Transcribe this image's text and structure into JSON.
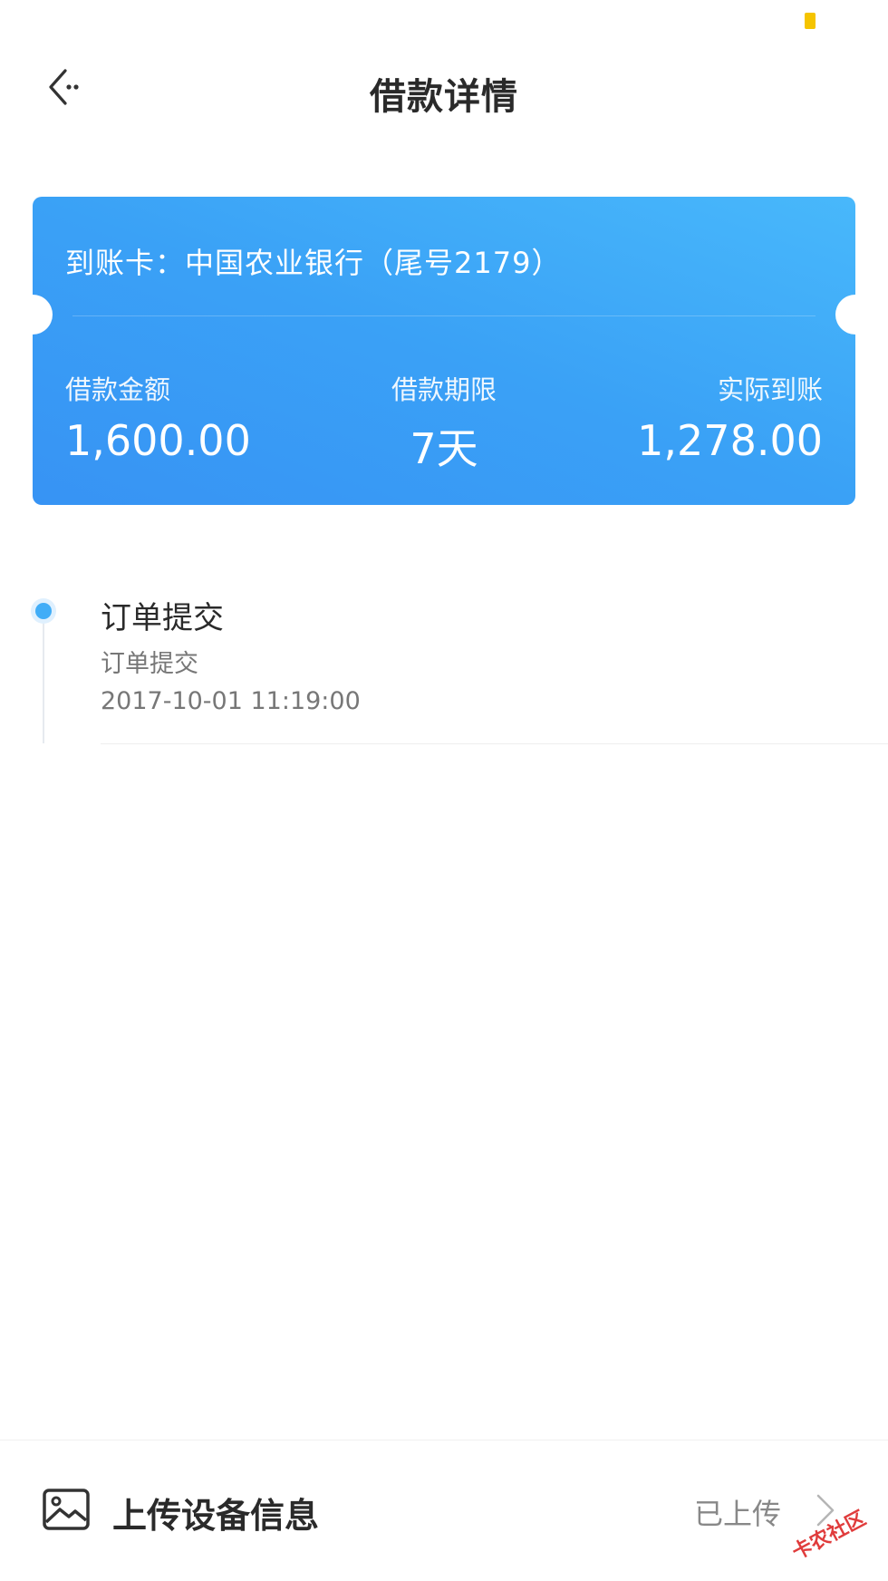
{
  "header": {
    "title": "借款详情",
    "back_icon": "back-arrow-icon"
  },
  "card": {
    "account_line": "到账卡：中国农业银行（尾号2179）",
    "stats": [
      {
        "label": "借款金额",
        "value": "1,600.00"
      },
      {
        "label": "借款期限",
        "value": "7天"
      },
      {
        "label": "实际到账",
        "value": "1,278.00"
      }
    ],
    "colors": {
      "gradient_start": "#48b8fb",
      "gradient_end": "#3793f4"
    }
  },
  "timeline": {
    "events": [
      {
        "title": "订单提交",
        "description": "订单提交",
        "time": "2017-10-01 11:19:00"
      }
    ],
    "dot_color": "#41adf7"
  },
  "bottom_bar": {
    "icon": "image-icon",
    "label": "上传设备信息",
    "status": "已上传",
    "chevron_icon": "chevron-right-icon"
  },
  "watermark": {
    "text": "卡农社区"
  }
}
